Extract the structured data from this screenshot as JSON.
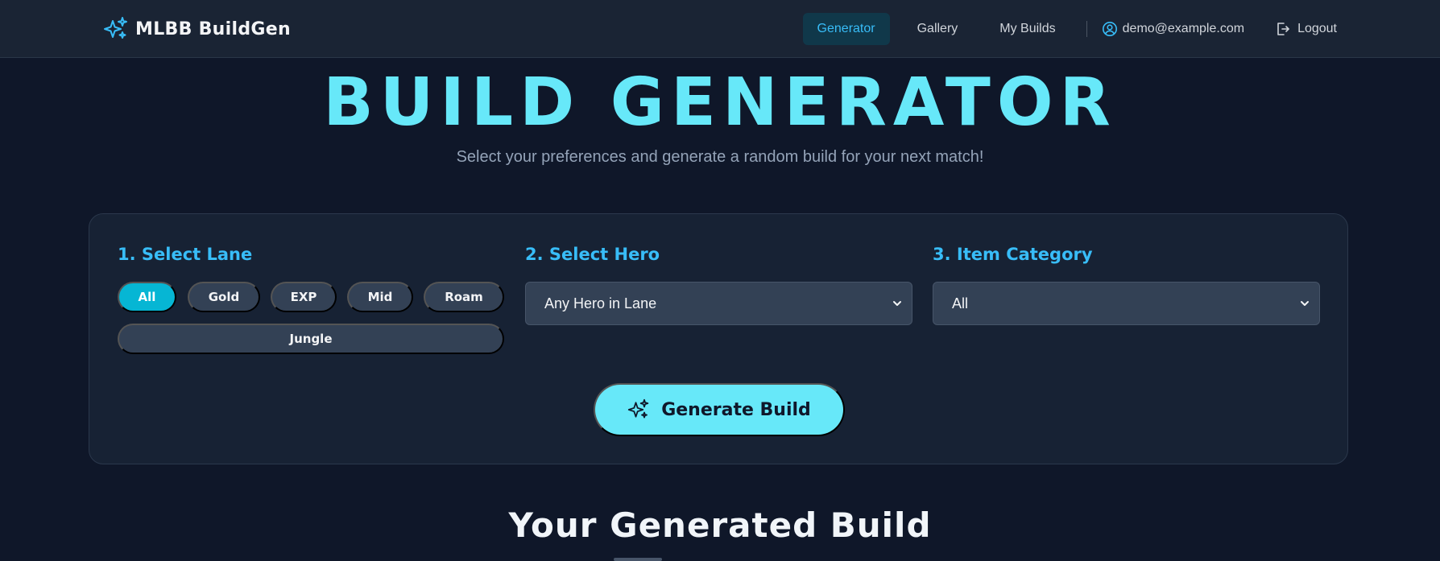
{
  "brand": {
    "name": "MLBB BuildGen",
    "accent": "#38bdf8"
  },
  "nav": {
    "links": [
      "Generator",
      "Gallery",
      "My Builds"
    ],
    "active": "Generator",
    "user_email": "demo@example.com",
    "logout_label": "Logout"
  },
  "hero": {
    "title": "BUILD GENERATOR",
    "subtitle": "Select your preferences and generate a random build for your next match!"
  },
  "form": {
    "lane_label": "1. Select Lane",
    "lanes": [
      "All",
      "Gold",
      "EXP",
      "Mid",
      "Roam",
      "Jungle"
    ],
    "selected_lane": "All",
    "hero_label": "2. Select Hero",
    "hero_value": "Any Hero in Lane",
    "category_label": "3. Item Category",
    "category_value": "All",
    "generate_label": "Generate Build"
  },
  "result": {
    "heading": "Your Generated Build"
  }
}
